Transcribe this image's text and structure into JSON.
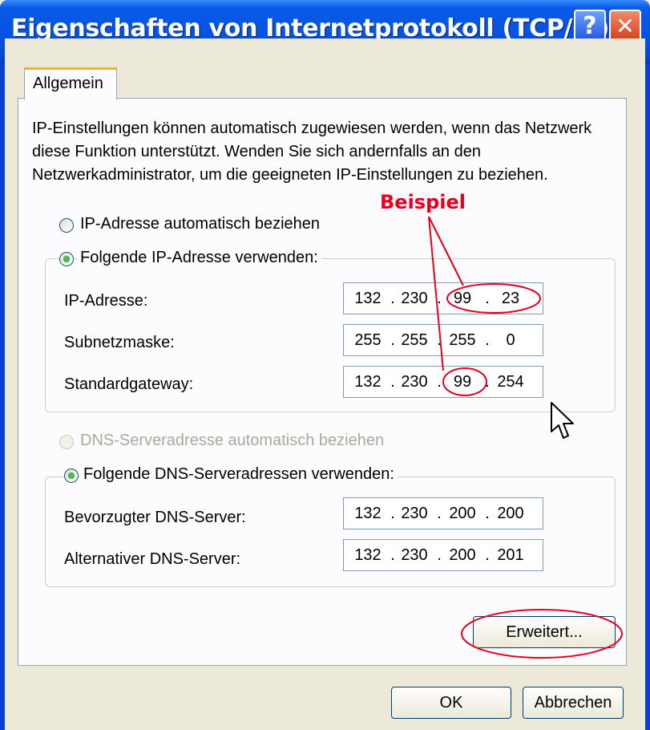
{
  "window": {
    "title": "Eigenschaften von Internetprotokoll (TCP/IP)",
    "help_label": "?",
    "close_label": "✕"
  },
  "tabs": [
    {
      "label": "Allgemein",
      "selected": true
    }
  ],
  "description": "IP-Einstellungen können automatisch zugewiesen werden, wenn das Netzwerk diese Funktion unterstützt. Wenden Sie sich andernfalls an den Netzwerkadministrator, um die geeigneten IP-Einstellungen zu beziehen.",
  "ip_section": {
    "auto_label": "IP-Adresse automatisch beziehen",
    "manual_label": "Folgende IP-Adresse verwenden:",
    "selected": "manual",
    "fields": [
      {
        "label": "IP-Adresse:",
        "octets": [
          "132",
          "230",
          "99",
          "23"
        ]
      },
      {
        "label": "Subnetzmaske:",
        "octets": [
          "255",
          "255",
          "255",
          "0"
        ]
      },
      {
        "label": "Standardgateway:",
        "octets": [
          "132",
          "230",
          "99",
          "254"
        ]
      }
    ]
  },
  "dns_section": {
    "auto_label": "DNS-Serveradresse automatisch beziehen",
    "auto_disabled": true,
    "manual_label": "Folgende DNS-Serveradressen verwenden:",
    "selected": "manual",
    "fields": [
      {
        "label": "Bevorzugter DNS-Server:",
        "octets": [
          "132",
          "230",
          "200",
          "200"
        ]
      },
      {
        "label": "Alternativer DNS-Server:",
        "octets": [
          "132",
          "230",
          "200",
          "201"
        ]
      }
    ]
  },
  "buttons": {
    "advanced": "Erweitert...",
    "ok": "OK",
    "cancel": "Abbrechen"
  },
  "annotation": {
    "label": "Beispiel",
    "color": "#e4001e"
  },
  "icons": [
    "help-icon",
    "close-icon",
    "mouse-cursor-icon"
  ]
}
